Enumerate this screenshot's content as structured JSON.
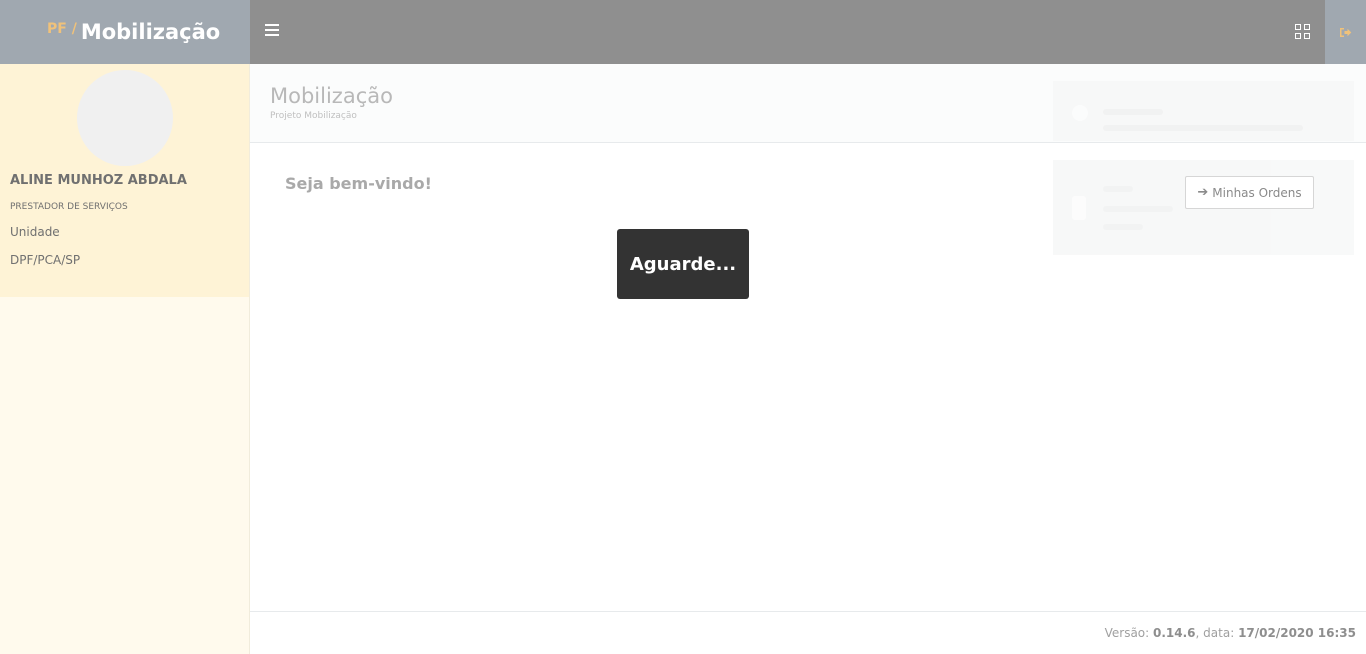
{
  "brand": {
    "prefix": "PF /",
    "title": "Mobilização"
  },
  "topbar": {
    "menu_icon": "hamburger-icon",
    "apps_icon": "grid-icon",
    "logout_icon": "sign-out-icon",
    "logout_color": "#f0c27a"
  },
  "sidebar": {
    "user_name": "ALINE MUNHOZ ABDALA",
    "user_role": "PRESTADOR DE SERVIÇOS",
    "unit_label": "Unidade",
    "unit_value": "DPF/PCA/SP"
  },
  "page": {
    "title": "Mobilização",
    "subtitle": "Projeto Mobilização"
  },
  "main": {
    "welcome": "Seja bem-vindo!",
    "orders_button": "Minhas Ordens",
    "loading_text": "Aguarde..."
  },
  "footer": {
    "version_label": "Versão:",
    "version": "0.14.6",
    "date_label": ", data:",
    "date": "17/02/2020 16:35"
  }
}
